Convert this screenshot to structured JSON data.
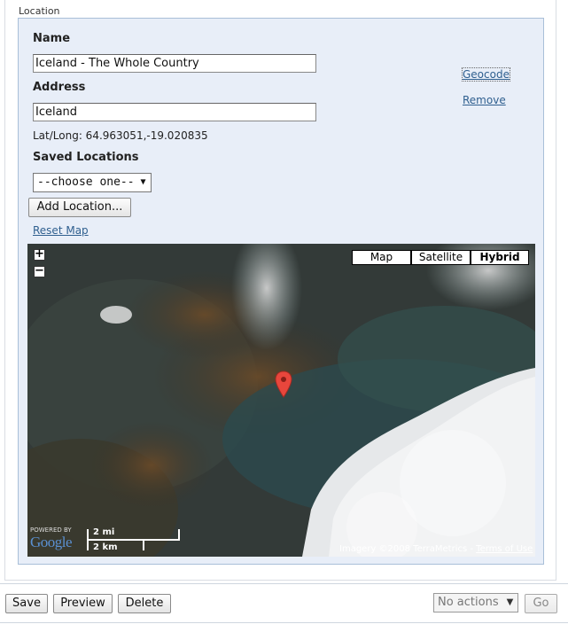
{
  "fieldset": {
    "legend": "Location"
  },
  "form": {
    "name_label": "Name",
    "name_value": "Iceland - The Whole Country",
    "address_label": "Address",
    "address_value": "Iceland",
    "latlong_text": "Lat/Long: 64.963051,-19.020835",
    "saved_label": "Saved Locations",
    "saved_selected": "--choose one--",
    "add_location_label": "Add Location...",
    "reset_map_label": "Reset Map",
    "geocode_label": "Geocode",
    "remove_label": "Remove"
  },
  "map": {
    "zoom_in": "+",
    "zoom_out": "−",
    "types": [
      "Map",
      "Satellite",
      "Hybrid"
    ],
    "active_type": "Hybrid",
    "scale_mi": "2 mi",
    "scale_km": "2 km",
    "powered_by": "POWERED BY",
    "google_logo": "Google",
    "imagery_credit": "Imagery ©2008 TerraMetrics - ",
    "terms_label": "Terms of Use",
    "marker_icon": "map-pin-marker"
  },
  "footer": {
    "save_label": "Save",
    "preview_label": "Preview",
    "delete_label": "Delete",
    "actions_selected": "No actions",
    "go_label": "Go"
  },
  "colors": {
    "panel_bg": "#e8eef8",
    "panel_border": "#a9bfd8",
    "link": "#2f5f8f",
    "marker": "#e8463c"
  }
}
